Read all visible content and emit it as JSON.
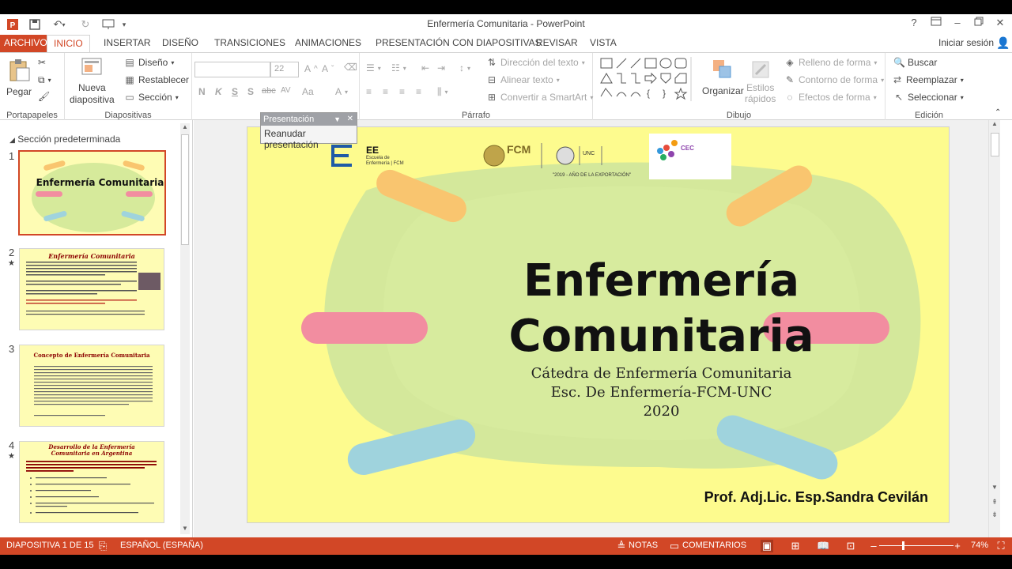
{
  "window": {
    "title": "Enfermería Comunitaria - PowerPoint",
    "help": "?",
    "signin": "Iniciar sesión"
  },
  "tabs": [
    "ARCHIVO",
    "INICIO",
    "INSERTAR",
    "DISEÑO",
    "TRANSICIONES",
    "ANIMACIONES",
    "PRESENTACIÓN CON DIAPOSITIVAS",
    "REVISAR",
    "VISTA"
  ],
  "ribbon": {
    "portapapeles": {
      "label": "Portapapeles",
      "pegar": "Pegar"
    },
    "diapositivas": {
      "label": "Diapositivas",
      "nueva": "Nueva",
      "nueva2": "diapositiva",
      "diseno": "Diseño",
      "restablecer": "Restablecer",
      "seccion": "Sección"
    },
    "fuente": {
      "size": "22",
      "n": "N",
      "k": "K",
      "s": "S",
      "abc": "abc",
      "av": "AV",
      "aa": "Aa"
    },
    "parrafo": {
      "label": "Párrafo",
      "direccion": "Dirección del texto",
      "alinear": "Alinear texto",
      "convertir": "Convertir a SmartArt"
    },
    "dibujo": {
      "label": "Dibujo",
      "organizar": "Organizar",
      "estilos": "Estilos",
      "estilos2": "rápidos",
      "relleno": "Relleno de forma",
      "contorno": "Contorno de forma",
      "efectos": "Efectos de forma"
    },
    "edicion": {
      "label": "Edición",
      "buscar": "Buscar",
      "reemplazar": "Reemplazar",
      "seleccionar": "Seleccionar"
    }
  },
  "floatbar": {
    "title": "Presentación",
    "button": "Reanudar presentación"
  },
  "slides_pane": {
    "section": "Sección predeterminada",
    "thumbs": [
      {
        "num": "1",
        "title": "Enfermería Comunitaria"
      },
      {
        "num": "2",
        "title": "Enfermería Comunitaria"
      },
      {
        "num": "3",
        "title": "Concepto de Enfermería Comunitaria"
      },
      {
        "num": "4",
        "title": "Desarrollo de la Enfermería Comunitaria en Argentina"
      }
    ]
  },
  "slide": {
    "title_line1": "Enfermería",
    "title_line2": "Comunitaria",
    "sub1": "Cátedra de Enfermería Comunitaria",
    "sub2": "Esc. De Enfermería-FCM-UNC",
    "sub3": "2020",
    "author": "Prof. Adj.Lic. Esp.Sandra Cevilán",
    "logo_ee": "EE",
    "logo_ee_sub1": "Escuela de",
    "logo_ee_sub2": "Enfermería | FCM",
    "logo_fcm": "FCM",
    "logo_unc": "UNC",
    "logo_year": "\"2019 - AÑO DE LA EXPORTACIÓN\"",
    "logo_cec": "CEC"
  },
  "statusbar": {
    "slide": "DIAPOSITIVA 1 DE 15",
    "lang": "ESPAÑOL (ESPAÑA)",
    "notas": "NOTAS",
    "comentarios": "COMENTARIOS",
    "zoom": "74%"
  },
  "colors": {
    "accent": "#d24726",
    "slide_bg": "#fdfb8e"
  }
}
